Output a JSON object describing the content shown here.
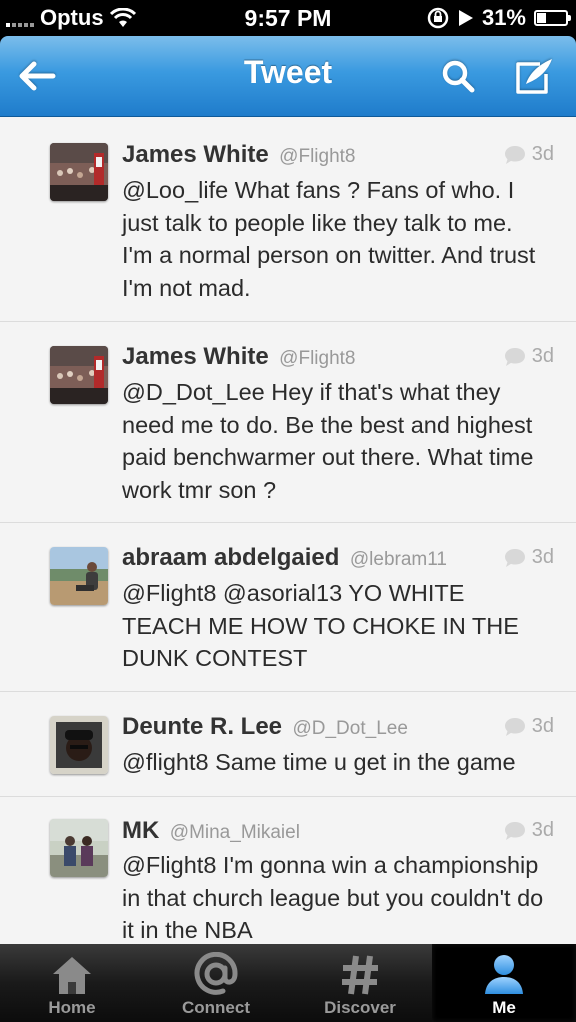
{
  "status_bar": {
    "carrier": "Optus",
    "time": "9:57 PM",
    "battery": "31%",
    "battery_level": 0.31
  },
  "nav": {
    "title": "Tweet"
  },
  "tweets": [
    {
      "name": "James White",
      "handle": "@Flight8",
      "time": "3d",
      "text": "@Loo_life What fans ? Fans of who. I just talk to people like they talk to me. I'm a normal person on twitter. And trust I'm not mad."
    },
    {
      "name": "James White",
      "handle": "@Flight8",
      "time": "3d",
      "text": "@D_Dot_Lee Hey if that's what they need me to do. Be the best and highest paid benchwarmer out there. What time work tmr son ?"
    },
    {
      "name": "abraam abdelgaied",
      "handle": "@lebram11",
      "time": "3d",
      "text": "@Flight8 @asorial13 YO WHITE TEACH ME HOW TO CHOKE IN THE DUNK CONTEST"
    },
    {
      "name": "Deunte R. Lee",
      "handle": "@D_Dot_Lee",
      "time": "3d",
      "text": "@flight8 Same time u get in the game"
    },
    {
      "name": "MK",
      "handle": "@Mina_Mikaiel",
      "time": "3d",
      "text": "@Flight8 I'm gonna win a championship in that church league but you couldn't do it in the NBA"
    }
  ],
  "tab_bar": {
    "tabs": [
      {
        "label": "Home",
        "icon": "home-icon"
      },
      {
        "label": "Connect",
        "icon": "at-icon"
      },
      {
        "label": "Discover",
        "icon": "hash-icon"
      },
      {
        "label": "Me",
        "icon": "person-icon"
      }
    ],
    "active": "Me"
  },
  "colors": {
    "nav_blue": "#3a9ae0",
    "tab_active": "#4aa3e8"
  }
}
